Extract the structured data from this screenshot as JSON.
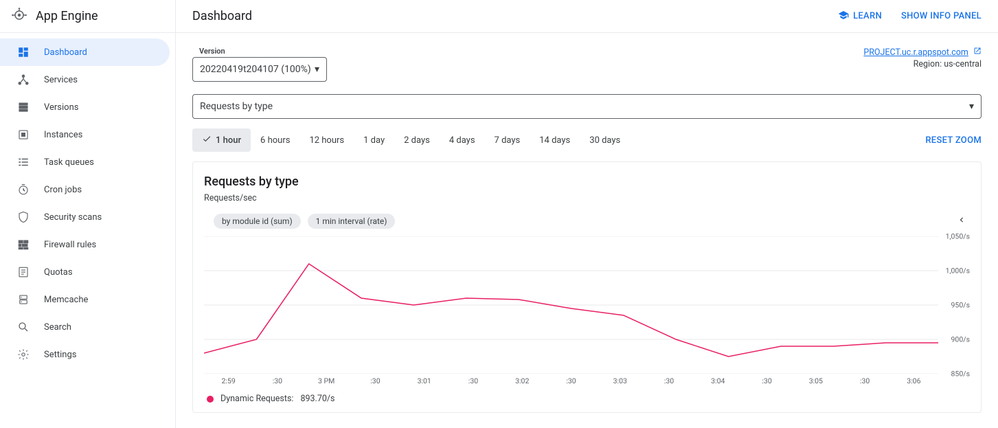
{
  "product": "App Engine",
  "page_title": "Dashboard",
  "topbar": {
    "learn": "LEARN",
    "show_info": "SHOW INFO PANEL"
  },
  "sidebar": {
    "items": [
      {
        "label": "Dashboard",
        "icon": "dashboard-icon",
        "active": true
      },
      {
        "label": "Services",
        "icon": "services-icon"
      },
      {
        "label": "Versions",
        "icon": "versions-icon"
      },
      {
        "label": "Instances",
        "icon": "instances-icon"
      },
      {
        "label": "Task queues",
        "icon": "queues-icon"
      },
      {
        "label": "Cron jobs",
        "icon": "cron-icon"
      },
      {
        "label": "Security scans",
        "icon": "security-icon"
      },
      {
        "label": "Firewall rules",
        "icon": "firewall-icon"
      },
      {
        "label": "Quotas",
        "icon": "quotas-icon"
      },
      {
        "label": "Memcache",
        "icon": "memcache-icon"
      },
      {
        "label": "Search",
        "icon": "search-icon"
      },
      {
        "label": "Settings",
        "icon": "settings-icon"
      }
    ]
  },
  "version": {
    "label": "Version",
    "selected": "20220419t204107 (100%)"
  },
  "project": {
    "url_text": "PROJECT.uc.r.appspot.com",
    "region_text": "Region: us-central"
  },
  "metric_selector": {
    "selected": "Requests by type"
  },
  "time_ranges": [
    "1 hour",
    "6 hours",
    "12 hours",
    "1 day",
    "2 days",
    "4 days",
    "7 days",
    "14 days",
    "30 days"
  ],
  "time_selected_index": 0,
  "reset_zoom": "RESET ZOOM",
  "chart": {
    "title": "Requests by type",
    "subtitle": "Requests/sec",
    "pills": [
      "by module id (sum)",
      "1 min interval (rate)"
    ],
    "legend_label": "Dynamic Requests:",
    "legend_value": "893.70/s"
  },
  "chart_data": {
    "type": "line",
    "title": "Requests by type",
    "ylabel": "Requests/sec",
    "ylim": [
      850,
      1050
    ],
    "y_ticks": [
      "1,050/s",
      "1,000/s",
      "950/s",
      "900/s",
      "850/s"
    ],
    "x_ticks": [
      "2:59",
      ":30",
      "3 PM",
      ":30",
      "3:01",
      ":30",
      "3:02",
      ":30",
      "3:03",
      ":30",
      "3:04",
      ":30",
      "3:05",
      ":30",
      "3:06"
    ],
    "series": [
      {
        "name": "Dynamic Requests",
        "color": "#e91e63",
        "values": [
          880,
          900,
          1010,
          960,
          950,
          960,
          958,
          945,
          935,
          900,
          875,
          890,
          890,
          895,
          895
        ]
      }
    ]
  }
}
